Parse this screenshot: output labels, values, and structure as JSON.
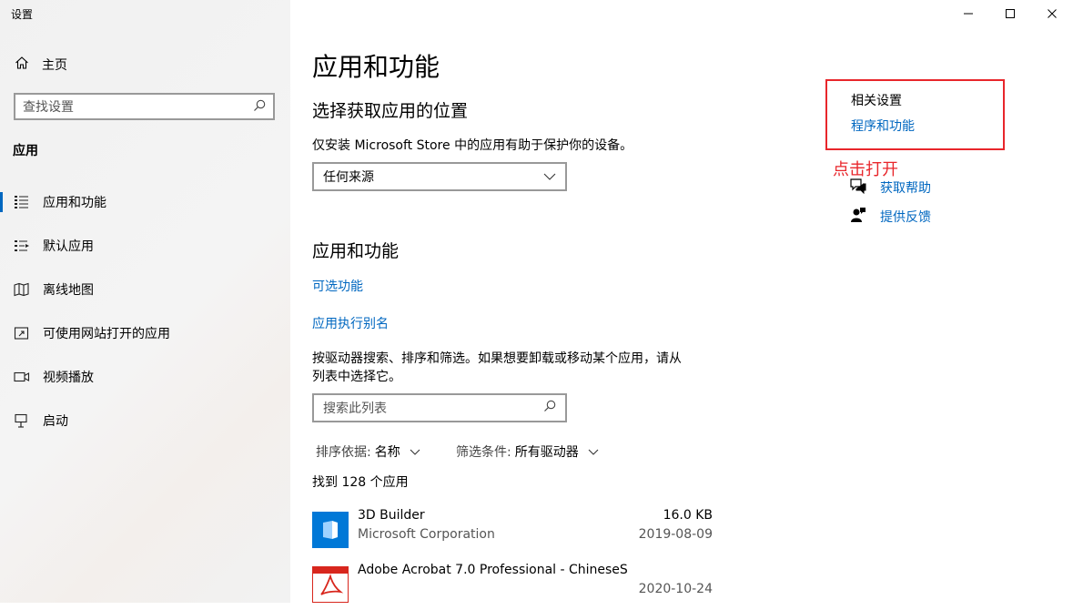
{
  "window": {
    "title": "设置",
    "controls": {
      "minimize": "minimize",
      "maximize": "maximize",
      "close": "close"
    }
  },
  "sidebar": {
    "home_label": "主页",
    "search_placeholder": "查找设置",
    "section_label": "应用",
    "items": [
      {
        "label": "应用和功能",
        "icon": "apps-features-icon",
        "selected": true
      },
      {
        "label": "默认应用",
        "icon": "default-apps-icon",
        "selected": false
      },
      {
        "label": "离线地图",
        "icon": "offline-maps-icon",
        "selected": false
      },
      {
        "label": "可使用网站打开的应用",
        "icon": "apps-for-websites-icon",
        "selected": false
      },
      {
        "label": "视频播放",
        "icon": "video-playback-icon",
        "selected": false
      },
      {
        "label": "启动",
        "icon": "startup-icon",
        "selected": false
      }
    ]
  },
  "main": {
    "title": "应用和功能",
    "install_section": {
      "heading": "选择获取应用的位置",
      "description": "仅安装 Microsoft Store 中的应用有助于保护你的设备。",
      "dropdown_value": "任何来源"
    },
    "apps_section": {
      "heading": "应用和功能",
      "optional_features_link": "可选功能",
      "app_alias_link": "应用执行别名",
      "description_line1": "按驱动器搜索、排序和筛选。如果想要卸载或移动某个应用，请从",
      "description_line2": "列表中选择它。",
      "search_placeholder": "搜索此列表",
      "sort_key": "排序依据:",
      "sort_value": "名称",
      "filter_key": "筛选条件:",
      "filter_value": "所有驱动器",
      "count_text": "找到 128 个应用",
      "apps": [
        {
          "name": "3D Builder",
          "publisher": "Microsoft Corporation",
          "size": "16.0 KB",
          "date": "2019-08-09",
          "tile_color": "#0078d7"
        },
        {
          "name": "Adobe Acrobat 7.0 Professional - ChineseS",
          "publisher": "",
          "size": "",
          "date": "2020-10-24",
          "tile_color": "#d8261d"
        }
      ]
    }
  },
  "related": {
    "title": "相关设置",
    "programs_link": "程序和功能",
    "annotation": "点击打开",
    "get_help": "获取帮助",
    "feedback": "提供反馈"
  },
  "colors": {
    "accent": "#0067c0",
    "annotation_red": "#e8262b"
  }
}
